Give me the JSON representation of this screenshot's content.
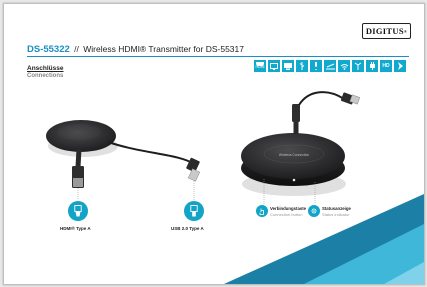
{
  "brand": {
    "logo_text": "DIGITUS"
  },
  "header": {
    "model": "DS-55322",
    "separator": "//",
    "description": "Wireless HDMI® Transmitter for DS-55317"
  },
  "section": {
    "title": "Anschlüsse",
    "subtitle": "Connections"
  },
  "feature_icons": [
    {
      "icon": "hdmi-icon",
      "caption": "HDMI"
    },
    {
      "icon": "screen-icon",
      "caption": ""
    },
    {
      "icon": "display-icon",
      "caption": ""
    },
    {
      "icon": "usb-icon",
      "caption": ""
    },
    {
      "icon": "audio-icon",
      "caption": ""
    },
    {
      "icon": "range-icon",
      "caption": ""
    },
    {
      "icon": "wifi-icon",
      "caption": ""
    },
    {
      "icon": "antenna-icon",
      "caption": ""
    },
    {
      "icon": "plug-icon",
      "caption": ""
    },
    {
      "icon": "hd-icon",
      "caption": "HD"
    },
    {
      "icon": "arrow-right-icon",
      "caption": ""
    }
  ],
  "connections": {
    "hdmi_label": "HDMI® Type A",
    "usb_label": "USB 2.0 Type A"
  },
  "device_labels": {
    "pairing_title": "Verbindungstaste",
    "pairing_sub": "Connection button",
    "status_title": "Statusanzeige",
    "status_sub": "Status indicator"
  },
  "device": {
    "button_text": "Wireless Connection"
  },
  "colors": {
    "accent": "#1a8fc6",
    "teal": "#12a3c6",
    "corner_dark": "#1c7fa6",
    "corner_light": "#3fb7d9"
  }
}
